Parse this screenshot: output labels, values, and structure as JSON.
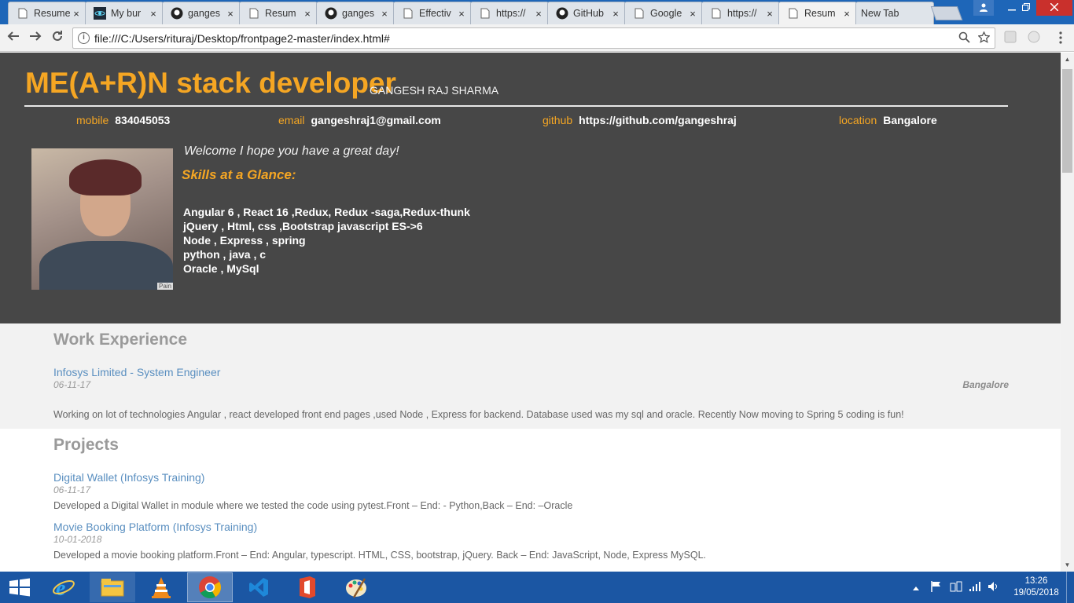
{
  "browser": {
    "tabs": [
      {
        "label": "Resume",
        "icon": "page-icon"
      },
      {
        "label": "My bur",
        "icon": "react-icon"
      },
      {
        "label": "ganges",
        "icon": "github-icon"
      },
      {
        "label": "Resum",
        "icon": "page-icon"
      },
      {
        "label": "ganges",
        "icon": "github-icon"
      },
      {
        "label": "Effectiv",
        "icon": "page-icon"
      },
      {
        "label": "https://",
        "icon": "page-icon"
      },
      {
        "label": "GitHub",
        "icon": "github-icon"
      },
      {
        "label": "Google",
        "icon": "page-icon"
      },
      {
        "label": "https://",
        "icon": "page-icon"
      },
      {
        "label": "Resum",
        "icon": "page-icon",
        "active": true
      },
      {
        "label": "New Tab",
        "icon": "none"
      }
    ],
    "close_glyph": "×",
    "url": "file:///C:/Users/rituraj/Desktop/frontpage2-master/index.html#"
  },
  "page": {
    "title": "ME(A+R)N stack developer",
    "subtitle": "GANGESH RAJ SHARMA",
    "contacts": [
      {
        "key": "mobile",
        "value": "834045053"
      },
      {
        "key": "email",
        "value": "gangeshraj1@gmail.com"
      },
      {
        "key": "github",
        "value": "https://github.com/gangeshraj"
      },
      {
        "key": "location",
        "value": "Bangalore"
      }
    ],
    "welcome": "Welcome I hope you have a great day!",
    "skills_title": "Skills at a Glance:",
    "skills": [
      "Angular 6 , React 16 ,Redux, Redux -saga,Redux-thunk",
      "jQuery , Html, css ,Bootstrap javascript ES->6",
      "Node , Express , spring",
      "python , java , c",
      "Oracle , MySql"
    ],
    "avatar_watermark": "Pain",
    "work": {
      "heading": "Work Experience",
      "title": "Infosys Limited - System Engineer",
      "date": "06-11-17",
      "location": "Bangalore",
      "description": "Working on lot of technologies Angular , react developed front end pages ,used Node , Express for backend. Database used was my sql and oracle. Recently Now moving to Spring 5 coding is fun!"
    },
    "projects": {
      "heading": "Projects",
      "items": [
        {
          "title": "Digital Wallet (Infosys Training)",
          "date": "06-11-17",
          "description": "Developed a Digital Wallet in module where we tested the code using pytest.Front – End: - Python,Back – End: –Oracle"
        },
        {
          "title": "Movie Booking Platform (Infosys Training)",
          "date": "10-01-2018",
          "description": "Developed a movie booking platform.Front – End: Angular, typescript. HTML, CSS, bootstrap, jQuery. Back – End: JavaScript, Node, Express MySQL."
        }
      ]
    }
  },
  "taskbar": {
    "apps": [
      "internet-explorer",
      "file-explorer",
      "vlc",
      "chrome",
      "visual-studio-code",
      "office",
      "paint"
    ],
    "time": "13:26",
    "date": "19/05/2018"
  },
  "colors": {
    "accent": "#f5a623",
    "hero_bg": "#474747",
    "link": "#5a8fc0",
    "taskbar": "#1b56a3",
    "tabstrip": "#1e66b8"
  }
}
